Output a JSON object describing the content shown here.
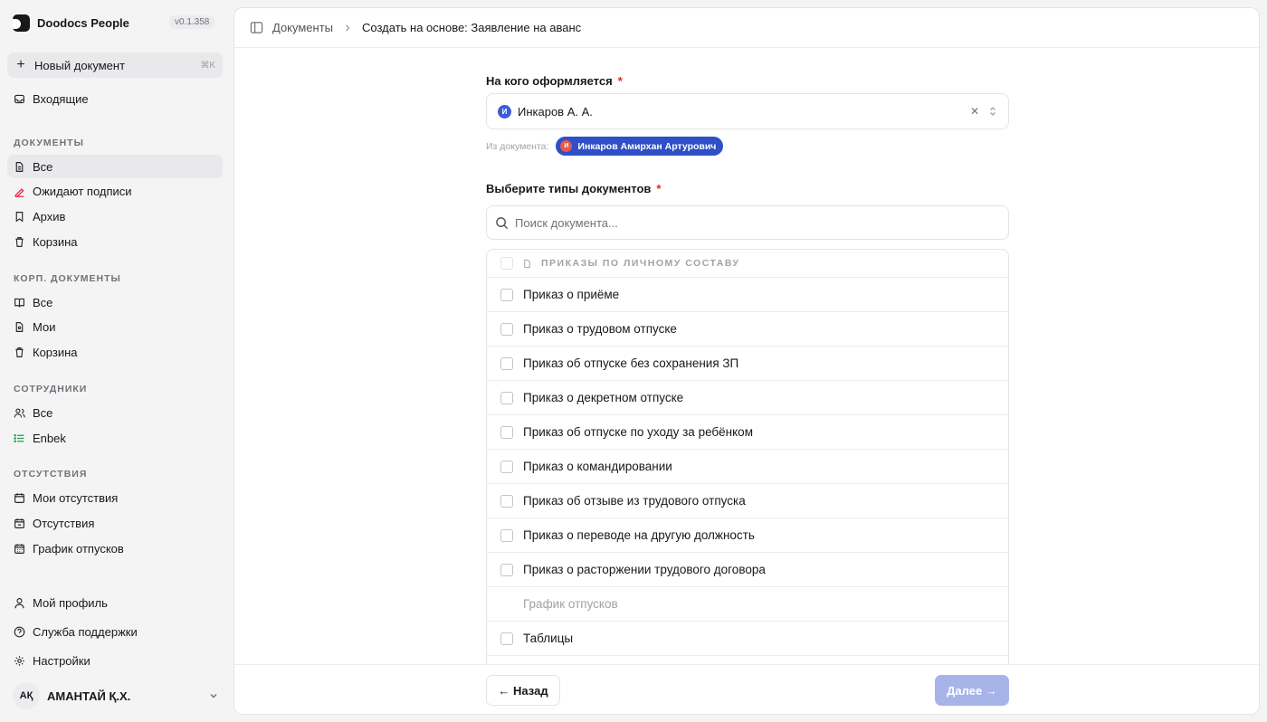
{
  "sidebar": {
    "app_name": "Doodocs People",
    "version": "v0.1.358",
    "new_document": {
      "label": "Новый документ",
      "shortcut": "⌘K"
    },
    "inbox": "Входящие",
    "sections": {
      "documents": {
        "title": "ДОКУМЕНТЫ",
        "items": [
          "Все",
          "Ожидают подписи",
          "Архив",
          "Корзина"
        ]
      },
      "corp": {
        "title": "КОРП. ДОКУМЕНТЫ",
        "items": [
          "Все",
          "Мои",
          "Корзина"
        ]
      },
      "employees": {
        "title": "СОТРУДНИКИ",
        "items": [
          "Все",
          "Enbek"
        ]
      },
      "absences": {
        "title": "ОТСУТСТВИЯ",
        "items": [
          "Мои отсутствия",
          "Отсутствия",
          "График отпусков"
        ]
      }
    },
    "bottom": {
      "profile": "Мой профиль",
      "support": "Служба поддержки",
      "settings": "Настройки"
    },
    "user": {
      "initials": "АҚ",
      "name": "АМАНТАЙ Қ.Х."
    }
  },
  "breadcrumb": {
    "root": "Документы",
    "current": "Создать на основе: Заявление на аванс"
  },
  "form": {
    "person_label": "На кого оформляется",
    "person_value": "Инкаров А. А.",
    "person_initial": "И",
    "from_doc_label": "Из документа:",
    "from_doc_chip": "Инкаров Амирхан Артурович",
    "from_doc_initial": "И",
    "types_label": "Выберите типы документов",
    "required_mark": "*",
    "search_placeholder": "Поиск документа...",
    "group_title": "ПРИКАЗЫ ПО ЛИЧНОМУ СОСТАВУ",
    "doc_types": [
      "Приказ о приёме",
      "Приказ о трудовом отпуске",
      "Приказ об отпуске без сохранения ЗП",
      "Приказ о декретном отпуске",
      "Приказ об отпуске по уходу за ребёнком",
      "Приказ о командировании",
      "Приказ об отзыве из трудового отпуска",
      "Приказ о переводе на другую должность",
      "Приказ о расторжении трудового договора",
      "График отпусков",
      "Таблицы"
    ]
  },
  "footer": {
    "back": "← Назад",
    "next": "Далее →"
  },
  "colors": {
    "accent": "#2f4fc7",
    "next_disabled": "#a7b4ea",
    "required": "#dc2626"
  }
}
